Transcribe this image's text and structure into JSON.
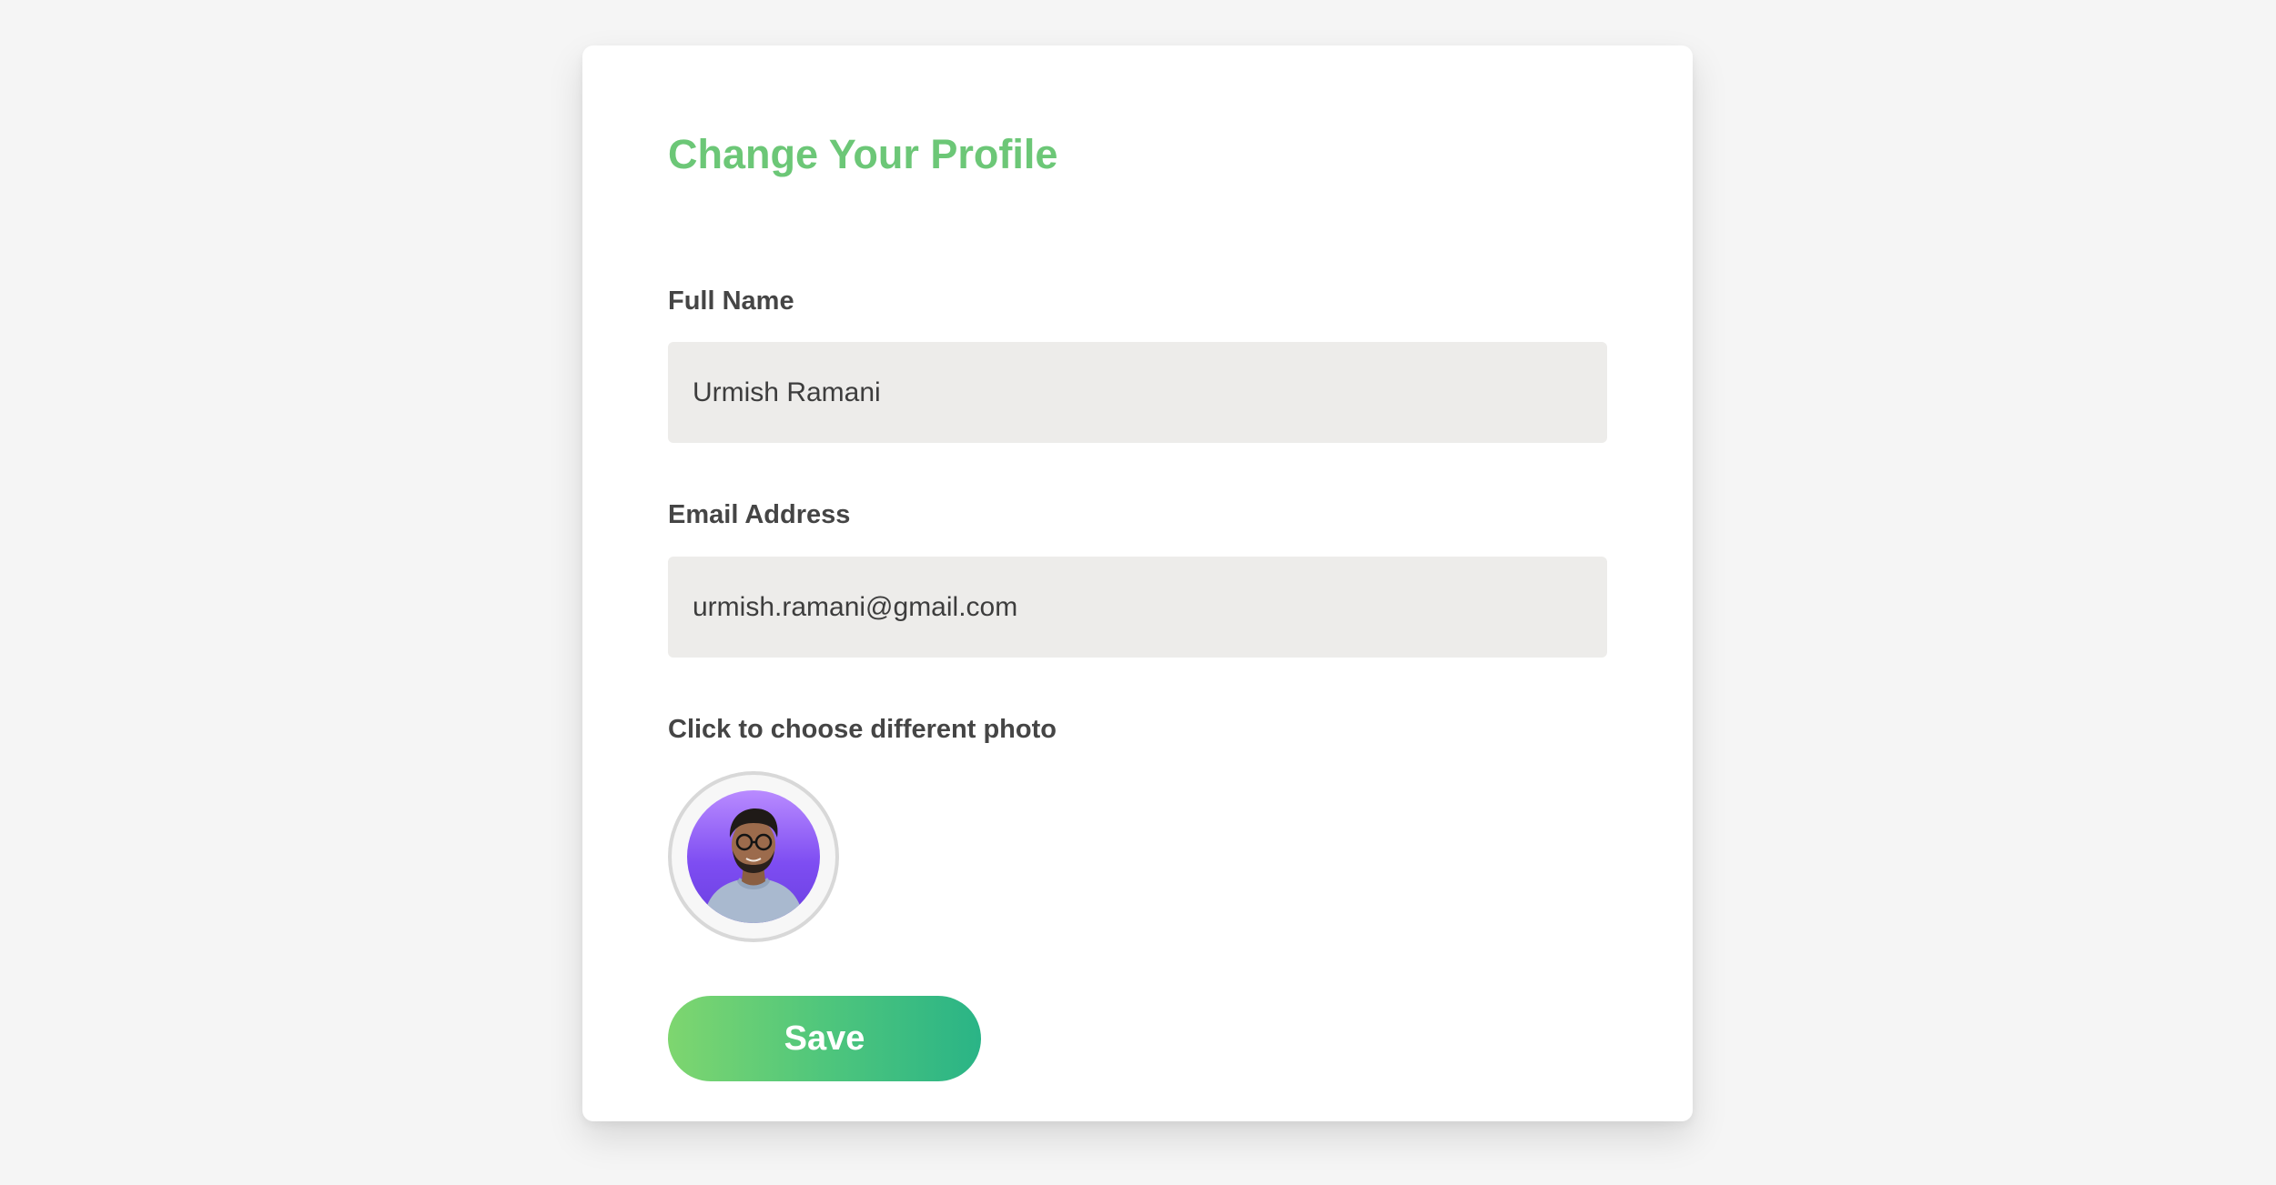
{
  "form": {
    "title": "Change Your Profile",
    "full_name_label": "Full Name",
    "full_name_value": "Urmish Ramani",
    "email_label": "Email Address",
    "email_value": "urmish.ramani@gmail.com",
    "photo_label": "Click to choose different photo",
    "save_label": "Save"
  },
  "colors": {
    "title": "#6cc777",
    "button_gradient_start": "#7ed66f",
    "button_gradient_end": "#2ab486",
    "field_background": "#edecea",
    "avatar_background": "#8a5cf0"
  }
}
